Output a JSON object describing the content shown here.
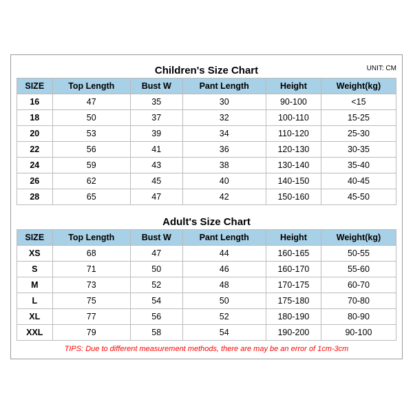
{
  "children_title": "Children's Size Chart",
  "adults_title": "Adult's Size Chart",
  "unit": "UNIT: CM",
  "children_headers": [
    "SIZE",
    "Top Length",
    "Bust W",
    "Pant Length",
    "Height",
    "Weight(kg)"
  ],
  "children_rows": [
    [
      "16",
      "47",
      "35",
      "30",
      "90-100",
      "<15"
    ],
    [
      "18",
      "50",
      "37",
      "32",
      "100-110",
      "15-25"
    ],
    [
      "20",
      "53",
      "39",
      "34",
      "110-120",
      "25-30"
    ],
    [
      "22",
      "56",
      "41",
      "36",
      "120-130",
      "30-35"
    ],
    [
      "24",
      "59",
      "43",
      "38",
      "130-140",
      "35-40"
    ],
    [
      "26",
      "62",
      "45",
      "40",
      "140-150",
      "40-45"
    ],
    [
      "28",
      "65",
      "47",
      "42",
      "150-160",
      "45-50"
    ]
  ],
  "adults_headers": [
    "SIZE",
    "Top Length",
    "Bust W",
    "Pant Length",
    "Height",
    "Weight(kg)"
  ],
  "adults_rows": [
    [
      "XS",
      "68",
      "47",
      "44",
      "160-165",
      "50-55"
    ],
    [
      "S",
      "71",
      "50",
      "46",
      "160-170",
      "55-60"
    ],
    [
      "M",
      "73",
      "52",
      "48",
      "170-175",
      "60-70"
    ],
    [
      "L",
      "75",
      "54",
      "50",
      "175-180",
      "70-80"
    ],
    [
      "XL",
      "77",
      "56",
      "52",
      "180-190",
      "80-90"
    ],
    [
      "XXL",
      "79",
      "58",
      "54",
      "190-200",
      "90-100"
    ]
  ],
  "tips": "TIPS: Due to different measurement methods, there are may be an error of 1cm-3cm"
}
